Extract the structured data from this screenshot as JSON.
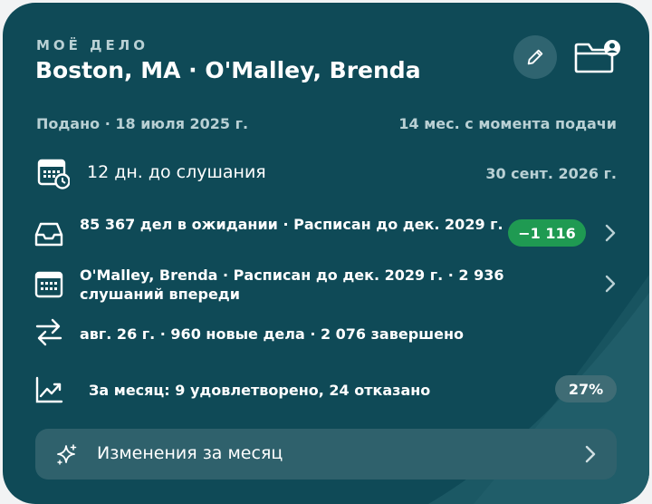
{
  "header": {
    "eyebrow": "МОЁ ДЕЛО",
    "title": "Boston, MA · O'Malley, Brenda"
  },
  "meta": {
    "filed": "Подано · 18 июля 2025 г.",
    "since_filing": "14 мес. с момента подачи"
  },
  "hearing": {
    "countdown": "12 дн. до слушания",
    "date": "30 сент. 2026 г."
  },
  "rows": [
    {
      "icon": "inbox-icon",
      "text": "85 367 дел в ожидании · Расписан до дек. 2029 г.",
      "badge": "−1 116"
    },
    {
      "icon": "calendar-icon",
      "text": "O'Malley, Brenda · Расписан до дек. 2029 г. · 2 936 слушаний впереди"
    },
    {
      "icon": "arrows-swap-icon",
      "text": "авг. 26 г. · 960 новые дела · 2 076 завершено"
    }
  ],
  "monthly": {
    "icon": "trend-up-icon",
    "text": "За месяц: 9 удовлетворено, 24 отказано",
    "rate": "27%"
  },
  "changes_button": {
    "icon": "sparkles-icon",
    "label": "Изменения за месяц"
  },
  "colors": {
    "card": "#0f4a57",
    "accent_green": "#1f9a52",
    "muted_text": "#b9d0d4"
  }
}
